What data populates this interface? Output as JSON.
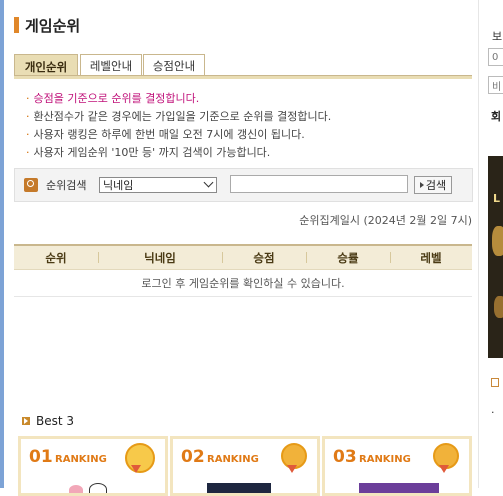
{
  "page": {
    "title": "게임순위"
  },
  "tabs": [
    {
      "label": "개인순위",
      "active": true
    },
    {
      "label": "레벨안내",
      "active": false
    },
    {
      "label": "승점안내",
      "active": false
    }
  ],
  "notes": [
    "승점을 기준으로 순위를 결정합니다.",
    "환산점수가 같은 경우에는 가입일을 기준으로 순위를 결정합니다.",
    "사용자 랭킹은 하루에 한번 매일 오전 7시에 갱신이 됩니다.",
    "사용자 게임순위 '10만 등' 까지 검색이 가능합니다."
  ],
  "search": {
    "label": "순위검색",
    "select_value": "닉네임",
    "input_value": "",
    "button_label": "검색"
  },
  "aggregation_time": "순위집계일시 (2024년 2월 2일 7시)",
  "table": {
    "headers": [
      "순위",
      "닉네임",
      "승점",
      "승률",
      "레벨"
    ],
    "empty_message": "로그인 후 게임순위를 확인하실 수 있습니다."
  },
  "best": {
    "title": "Best 3",
    "cards": [
      {
        "num": "01",
        "label": "RANKING"
      },
      {
        "num": "02",
        "label": "RANKING"
      },
      {
        "num": "03",
        "label": "RANKING"
      }
    ]
  },
  "sidebar": {
    "label": "보",
    "field1": "0",
    "field2": "비",
    "bold": "회",
    "banner_letter": "L"
  },
  "colors": {
    "accent": "#e0872a",
    "highlight": "#c0117a",
    "tab_active": "#e9ddb4"
  }
}
